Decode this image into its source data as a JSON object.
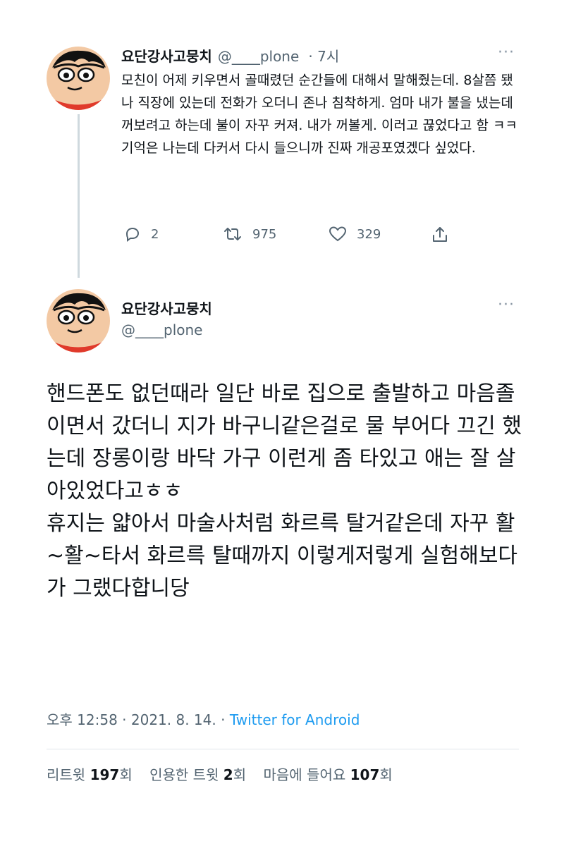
{
  "thread_parent": {
    "author_name": "요단강사고뭉치",
    "author_handle": "@____plone",
    "time": "· 7시",
    "more": "···",
    "text": "모친이 어제 키우면서 골때렸던 순간들에 대해서 말해줬는데. 8살쯤 됐나 직장에 있는데 전화가 오더니 존나 침착하게. 엄마 내가 불을 냈는데 꺼보려고 하는데 불이 자꾸 커져. 내가 꺼볼게. 이러고 끊었다고 함 ㅋㅋ 기억은 나는데 다커서 다시 들으니까 진짜 개공포였겠다 싶었다.",
    "actions": {
      "replies": "2",
      "retweets": "975",
      "likes": "329"
    }
  },
  "tweet": {
    "author_name": "요단강사고뭉치",
    "author_handle": "@____plone",
    "more": "···",
    "paragraphs": [
      "핸드폰도 없던때라 일단 바로 집으로 출발하고 마음졸이면서 갔더니 지가 바구니같은걸로 물 부어다 끄긴 했는데 장롱이랑 바닥 가구 이런게 좀 타있고 애는 잘 살아있었다고ㅎㅎ",
      "휴지는 얇아서 마술사처럼 화르륵 탈거같은데 자꾸 활~활~타서 화르륵 탈때까지 이렇게저렇게 실험해보다가 그랬다합니당"
    ],
    "meta": {
      "time": "오후 12:58",
      "date": "2021. 8. 14.",
      "separator": "·",
      "source": "Twitter for Android"
    },
    "stats": {
      "retweet_label": "리트윗",
      "retweet_count": "197",
      "quote_label": "인용한 트윗",
      "quote_count": "2",
      "like_label": "마음에 들어요",
      "like_count": "107",
      "unit": "회"
    }
  },
  "colors": {
    "text_primary": "#0f1419",
    "text_secondary": "#536471",
    "link": "#1d9bf0",
    "thread_line": "#cfd9de"
  },
  "icons": {
    "reply": "reply-icon",
    "retweet": "retweet-icon",
    "like": "heart-icon",
    "share": "share-icon",
    "more": "more-icon"
  }
}
